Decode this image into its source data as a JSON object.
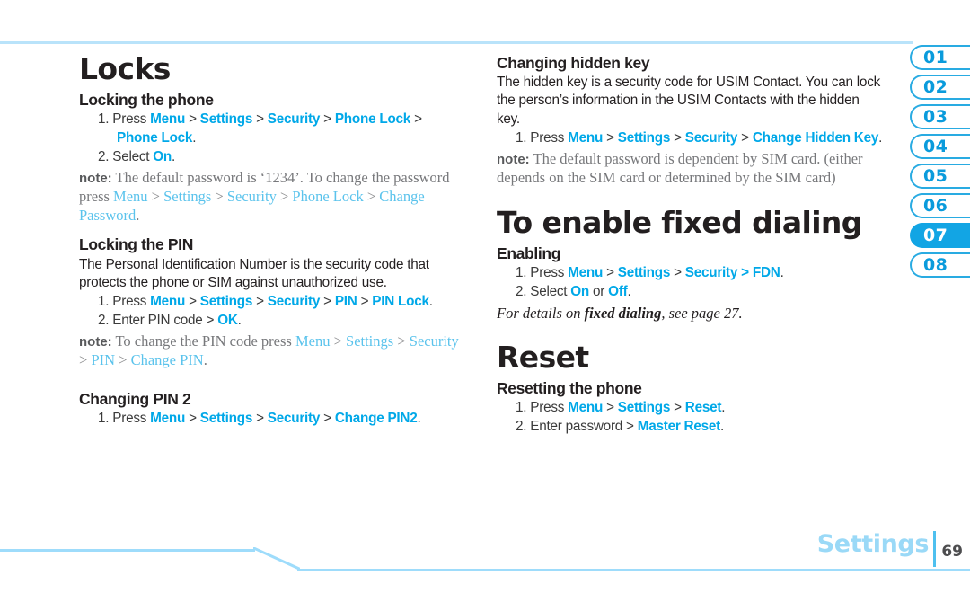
{
  "document": {
    "footer": {
      "chapter_label": "Settings",
      "page_number": "69",
      "divider_color": "#4ec0ef",
      "label_color": "#9ad9f7"
    },
    "accent_color": "#00a8e8",
    "rule_color": "#b9e3fa"
  },
  "tabs": {
    "items": [
      {
        "label": "01",
        "active": false
      },
      {
        "label": "02",
        "active": false
      },
      {
        "label": "03",
        "active": false
      },
      {
        "label": "04",
        "active": false
      },
      {
        "label": "05",
        "active": false
      },
      {
        "label": "06",
        "active": false
      },
      {
        "label": "07",
        "active": true
      },
      {
        "label": "08",
        "active": false
      }
    ],
    "active_color": "#12a5e4",
    "inactive_color": "#0a9bdc"
  },
  "left_column": {
    "chapter_title": "Locks",
    "s1": {
      "heading": "Locking the phone",
      "step1_num": "1.",
      "step1_press": "Press",
      "step1_k1": "Menu",
      "step1_k2": "Settings",
      "step1_k3": "Security",
      "step1_k4": "Phone Lock",
      "step1_k5": "Phone Lock",
      "step1_period": ".",
      "step2_num": "2.",
      "step2_select": "Select",
      "step2_k1": "On",
      "step2_period": ".",
      "note_lead": "note:",
      "note_a": "The default password is ‘1234’. To change the password press",
      "note_k1": "Menu",
      "note_k2": "Settings",
      "note_k3": "Security",
      "note_k4": "Phone Lock",
      "note_k5": "Change Password",
      "note_end": "."
    },
    "s2": {
      "heading": "Locking the PIN",
      "body": "The Personal Identification Number is the security code that protects the phone or SIM against unauthorized use.",
      "step1_num": "1.",
      "step1_press": "Press",
      "step1_k1": "Menu",
      "step1_k2": "Settings",
      "step1_k3": "Security",
      "step1_k4": "PIN",
      "step1_k5": "PIN Lock",
      "step1_period": ".",
      "step2_num": "2.",
      "step2_text": "Enter PIN code",
      "step2_k1": "OK",
      "step2_period": ".",
      "note_lead": "note:",
      "note_a": "To change the PIN code press",
      "note_k1": "Menu",
      "note_k2": "Settings",
      "note_k3": "Security",
      "note_k4": "PIN",
      "note_k5": "Change PIN",
      "note_end": "."
    },
    "s3": {
      "heading": "Changing PIN 2",
      "step1_num": "1.",
      "step1_press": "Press",
      "step1_k1": "Menu",
      "step1_k2": "Settings",
      "step1_k3": "Security",
      "step1_k4": "Change PIN2",
      "step1_period": "."
    }
  },
  "right_column": {
    "s1": {
      "heading": "Changing hidden key",
      "body": "The hidden key is a security code for USIM Contact. You can lock the person’s information in the USIM Contacts with the hidden key.",
      "step1_num": "1.",
      "step1_press": "Press",
      "step1_k1": "Menu",
      "step1_k2": "Settings",
      "step1_k3": "Security",
      "step1_k4": "Change Hidden Key",
      "step1_period": ".",
      "note_lead": "note:",
      "note_a": "The default password is dependent by SIM card. (either depends on the SIM card or determined by the SIM card)"
    },
    "chapter_title_2": "To enable fixed dialing",
    "s2": {
      "heading": "Enabling",
      "step1_num": "1.",
      "step1_press": "Press",
      "step1_k1": "Menu",
      "step1_k2": "Settings",
      "step1_k3": "Security",
      "step1_k4": "FDN",
      "step1_period": ".",
      "step2_num": "2.",
      "step2_select": "Select",
      "step2_k1": "On",
      "step2_or": "or",
      "step2_k2": "Off",
      "step2_period": ".",
      "xref_a": "For details on ",
      "xref_b": "fixed dialing",
      "xref_c": ", see page 27."
    },
    "chapter_title_3": "Reset",
    "s3": {
      "heading": "Resetting the phone",
      "step1_num": "1.",
      "step1_press": "Press",
      "step1_k1": "Menu",
      "step1_k2": "Settings",
      "step1_k3": "Reset",
      "step1_period": ".",
      "step2_num": "2.",
      "step2_text": "Enter password",
      "step2_k1": "Master Reset",
      "step2_period": "."
    }
  },
  "symbols": {
    "gt": ">"
  }
}
